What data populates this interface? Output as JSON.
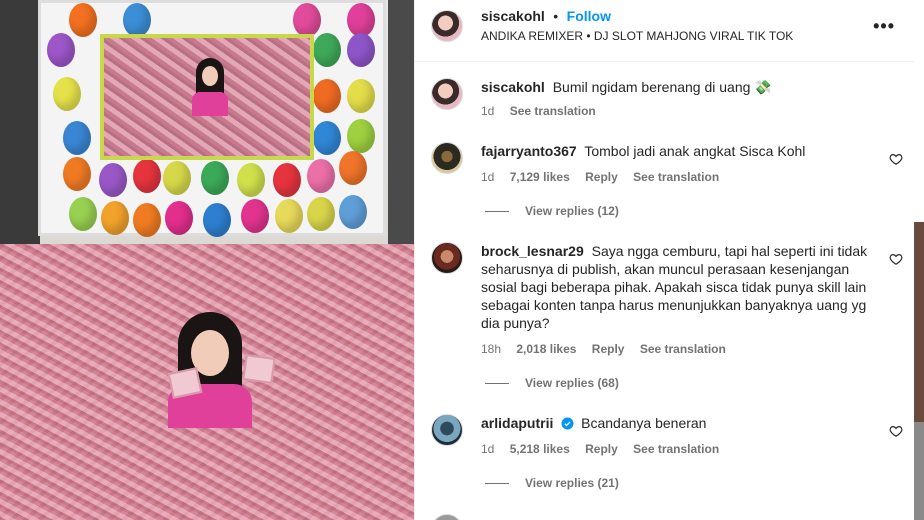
{
  "post": {
    "author": "siscakohl",
    "separator": "•",
    "follow_label": "Follow",
    "audio": "ANDIKA REMIXER • DJ SLOT MAHJONG VIRAL TIK TOK",
    "more_label": "•••"
  },
  "caption": {
    "username": "siscakohl",
    "text": "Bumil ngidam berenang di uang 💸",
    "time": "1d",
    "see_translation": "See translation"
  },
  "comments": [
    {
      "username": "fajarryanto367",
      "text": "Tombol jadi anak angkat Sisca Kohl",
      "time": "1d",
      "likes": "7,129 likes",
      "reply": "Reply",
      "see_translation": "See translation",
      "view_replies": "View replies (12)"
    },
    {
      "username": "brock_lesnar29",
      "text": "Saya ngga cemburu, tapi hal seperti ini tidak seharusnya di publish, akan muncul perasaan kesenjangan sosial bagi beberapa pihak. Apakah sisca tidak punya skill lain sebagai konten tanpa harus menunjukkan banyaknya uang yg dia punya?",
      "time": "18h",
      "likes": "2,018 likes",
      "reply": "Reply",
      "see_translation": "See translation",
      "view_replies": "View replies (68)"
    },
    {
      "username": "arlidaputrii",
      "verified": true,
      "text": "Bcandanya beneran",
      "time": "1d",
      "likes": "5,218 likes",
      "reply": "Reply",
      "see_translation": "See translation",
      "view_replies": "View replies (21)"
    }
  ],
  "colors": {
    "follow": "#0095f6",
    "text": "#262626",
    "muted": "#737373",
    "verified": "#0095f6"
  }
}
